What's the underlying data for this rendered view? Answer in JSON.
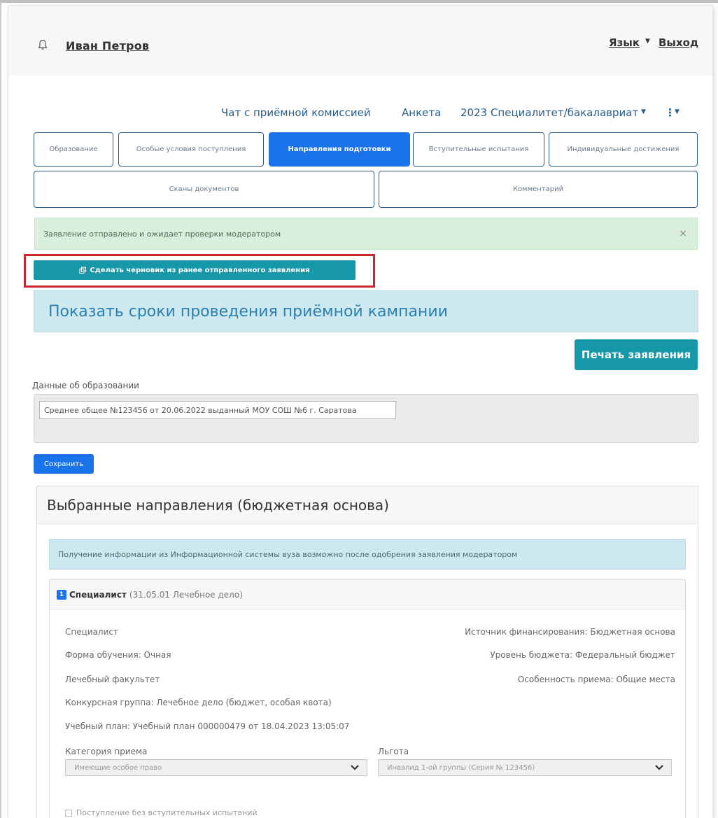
{
  "header": {
    "username": "Иван Петров",
    "language": "Язык",
    "logout": "Выход"
  },
  "nav": {
    "chat": "Чат с приёмной комиссией",
    "profile": "Анкета",
    "campaign": "2023 Специалитет/бакалавриат"
  },
  "tabs": {
    "education": "Образование",
    "special_conditions": "Особые условия поступления",
    "directions": "Направления подготовки",
    "exams": "Вступительные испытания",
    "achievements": "Индивидуальные достижения",
    "scans": "Сканы документов",
    "comment": "Комментарий"
  },
  "status_alert": {
    "text": "Заявление отправлено и ожидает проверки модератором",
    "close": "×"
  },
  "draft_button": "Сделать черновик из ранее отправленного заявления",
  "campaign_dates": "Показать сроки проведения приёмной кампании",
  "print_button": "Печать заявления",
  "education": {
    "label": "Данные об образовании",
    "value": "Среднее общее №123456 от 20.06.2022 выданный МОУ СОШ №6 г. Саратова"
  },
  "save_button": "Сохранить",
  "selected": {
    "title": "Выбранные направления (бюджетная основа)",
    "info": "Получение информации из Информационной системы вуза возможно после одобрения заявления модератором",
    "direction": {
      "number": "1",
      "title": "Специалист",
      "subtitle": "(31.05.01 Лечебное дело)",
      "level": "Специалист",
      "form": "Форма обучения: Очная",
      "faculty": "Лечебный факультет",
      "group": "Конкурсная группа: Лечебное дело (бюджет, особая квота)",
      "plan": "Учебный план: Учебный план 000000479 от 18.04.2023 13:05:07",
      "funding": "Источник финансирования: Бюджетная основа",
      "budget_level": "Уровень бюджета: Федеральный бюджет",
      "admission_feature": "Особенность приема: Общие места",
      "category_label": "Категория приема",
      "category_value": "Имеющие особое право",
      "benefit_label": "Льгота",
      "benefit_value": "Инвалид 1-ой группы (Серия  № 123456)",
      "no_exams": "Поступление без вступительных испытаний"
    }
  }
}
